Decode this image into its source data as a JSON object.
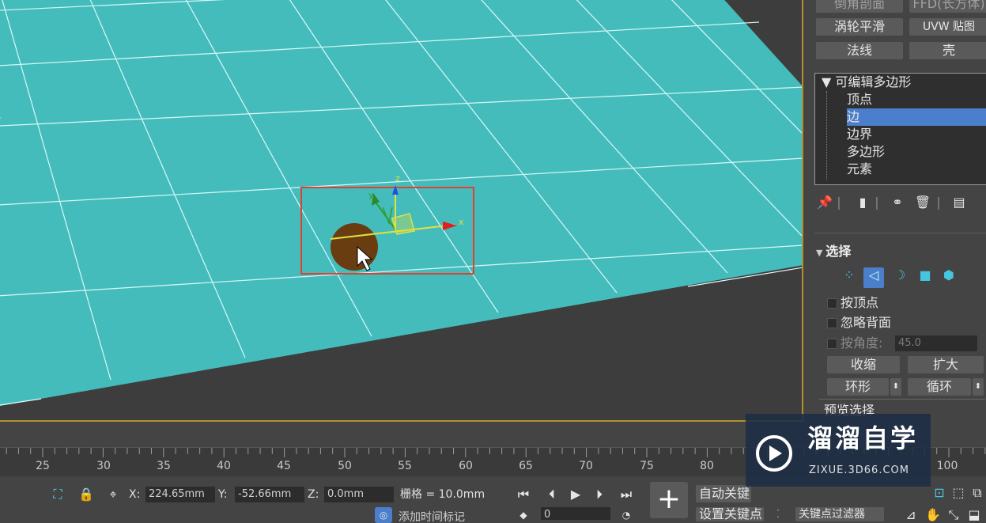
{
  "modifier_buttons": {
    "row0": [
      "倒角剖面",
      "FFD(长方体)"
    ],
    "row1": [
      "涡轮平滑",
      "UVW 贴图"
    ],
    "row2": [
      "法线",
      "壳"
    ]
  },
  "modifier_stack": {
    "root": "可编辑多边形",
    "items": [
      "顶点",
      "边",
      "边界",
      "多边形",
      "元素"
    ],
    "selected": "边"
  },
  "selection_rollout": {
    "title": "选择",
    "by_vertex": "按顶点",
    "ignore_backfacing": "忽略背面",
    "by_angle": "按角度:",
    "angle_value": "45.0",
    "shrink": "收缩",
    "grow": "扩大",
    "ring": "环形",
    "loop": "循环",
    "preview": "预览选择"
  },
  "timeline": {
    "ticks": [
      "25",
      "30",
      "35",
      "40",
      "45",
      "50",
      "55",
      "60",
      "65",
      "70",
      "75",
      "80",
      "100"
    ]
  },
  "status": {
    "x_label": "X:",
    "x_value": "224.65mm",
    "y_label": "Y:",
    "y_value": "-52.66mm",
    "z_label": "Z:",
    "z_value": "0.0mm",
    "grid_label": "栅格 = 10.0mm",
    "autokey": "自动关键",
    "set_key": "设置关键点",
    "key_filter": "关键点过滤器",
    "frame_value": "0",
    "time_tag": "添加时间标记"
  },
  "viewport": {
    "gizmo_axes": [
      "z",
      "y",
      "x"
    ]
  },
  "watermark": {
    "title": "溜溜自学",
    "url": "ZIXUE.3D66.COM"
  },
  "colors": {
    "plane": "#45bcbc",
    "grid_line": "#e8ffff",
    "selection_box": "#e04030",
    "highlight": "#4c7fcb",
    "frame": "#b38f2e"
  }
}
